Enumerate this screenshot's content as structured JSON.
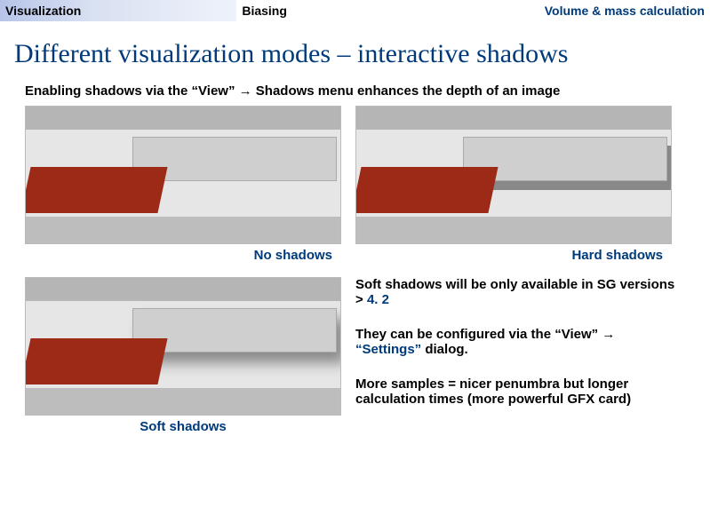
{
  "tabs": {
    "visualization": "Visualization",
    "biasing": "Biasing",
    "volmass": "Volume & mass calculation"
  },
  "title": "Different visualization modes – interactive shadows",
  "intro": "Enabling shadows via the “View” → Shadows menu enhances the depth of an image",
  "captions": {
    "none": "No shadows",
    "hard": "Hard shadows",
    "soft": "Soft shadows"
  },
  "notes": {
    "p1_a": "Soft shadows will be only available in SG versions > ",
    "p1_b": "4. 2",
    "p2_a": "They can be configured via the “View” → ",
    "p2_b": "“Settings”",
    "p2_c": " dialog.",
    "p3": "More samples = nicer penumbra but longer calculation times (more powerful GFX card)"
  }
}
